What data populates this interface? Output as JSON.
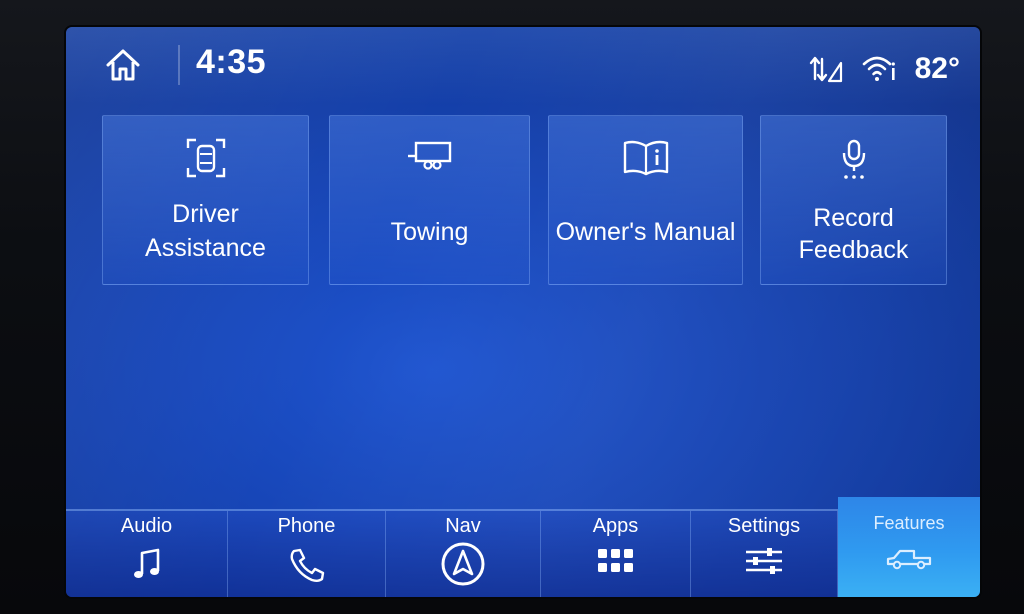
{
  "status": {
    "time": "4:35",
    "temperature": "82°"
  },
  "tiles": [
    {
      "line1": "Driver",
      "line2": "Assistance",
      "icon": "driver-assistance-icon"
    },
    {
      "line1": "Towing",
      "line2": "",
      "icon": "trailer-icon"
    },
    {
      "line1": "Owner's Manual",
      "line2": "",
      "icon": "manual-book-icon"
    },
    {
      "line1": "Record",
      "line2": "Feedback",
      "icon": "microphone-icon"
    }
  ],
  "bottom_nav": [
    {
      "label": "Audio",
      "icon": "music-note-icon"
    },
    {
      "label": "Phone",
      "icon": "phone-icon"
    },
    {
      "label": "Nav",
      "icon": "navigation-compass-icon"
    },
    {
      "label": "Apps",
      "icon": "apps-grid-icon"
    },
    {
      "label": "Settings",
      "icon": "sliders-icon"
    },
    {
      "label": "Features",
      "icon": "truck-icon",
      "active": true
    }
  ],
  "colors": {
    "screen_bg": "#1746b8",
    "features_active": "#2f9af0",
    "text": "#ffffff"
  }
}
